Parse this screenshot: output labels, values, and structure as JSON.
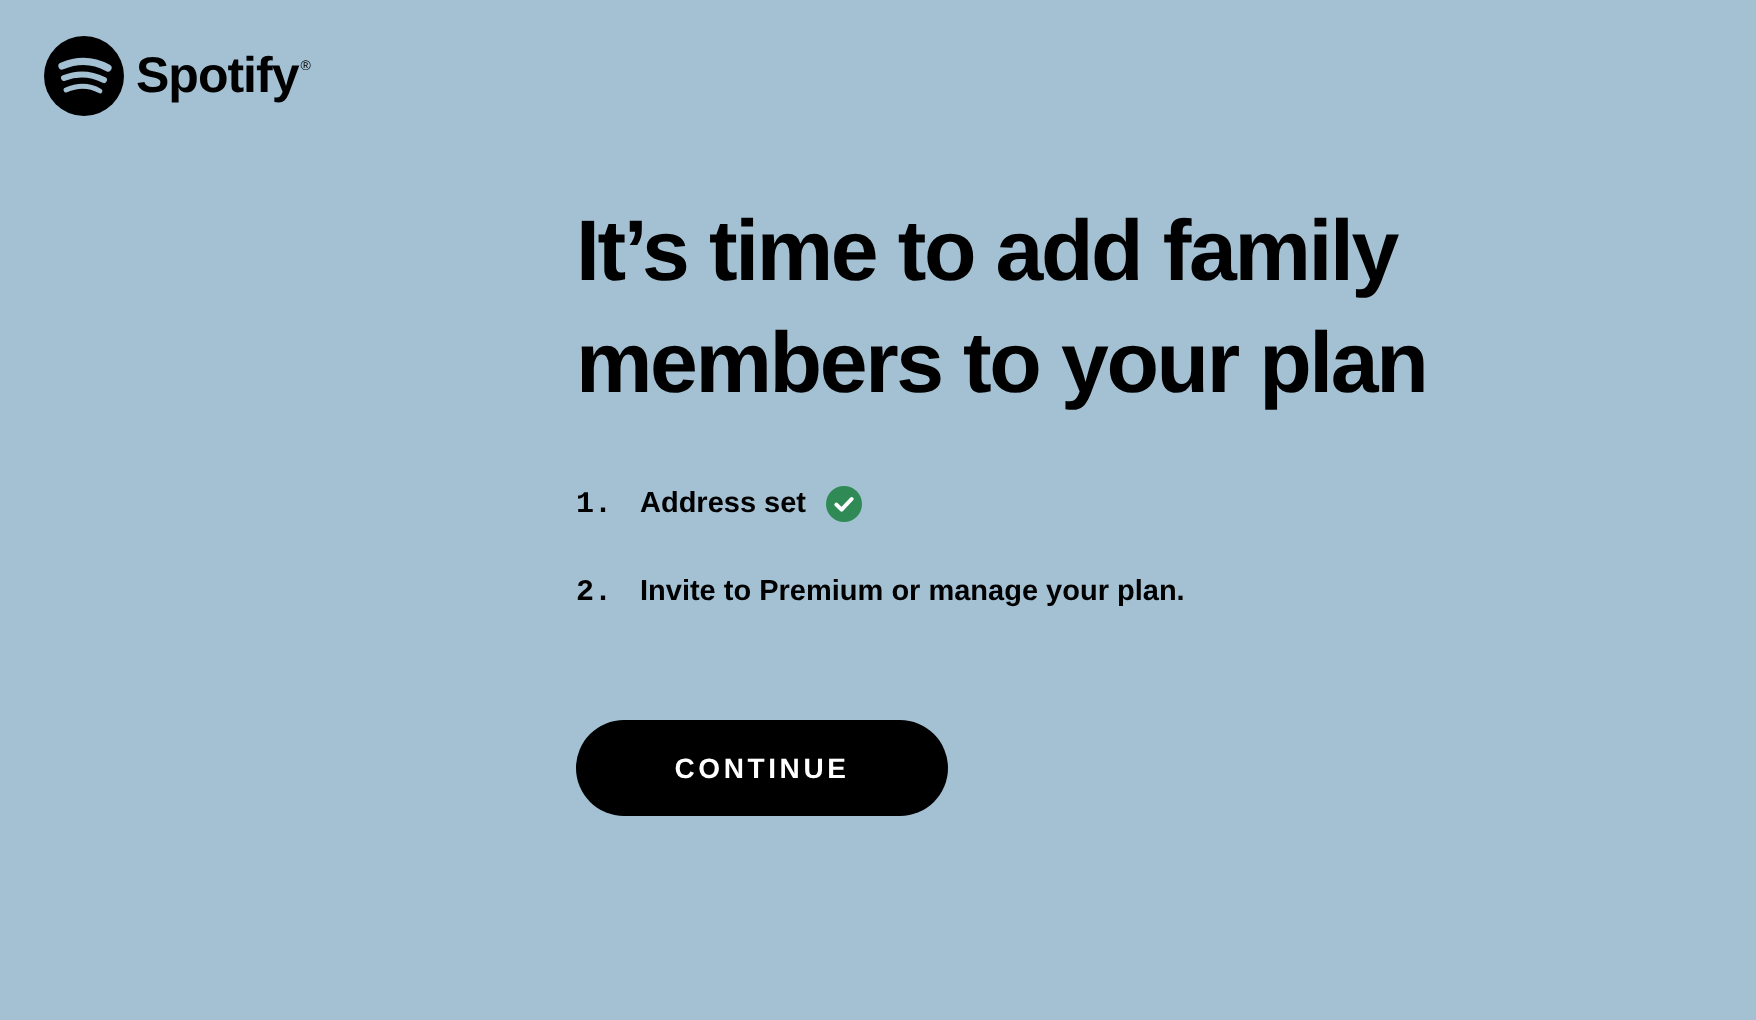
{
  "logo": {
    "text": "Spotify",
    "mark": "®"
  },
  "heading": "It’s time to add family members to your plan",
  "steps": [
    {
      "number": "1.",
      "text": "Address set",
      "done": true
    },
    {
      "number": "2.",
      "text": "Invite to Premium or manage your plan.",
      "done": false
    }
  ],
  "button": "CONTINUE"
}
